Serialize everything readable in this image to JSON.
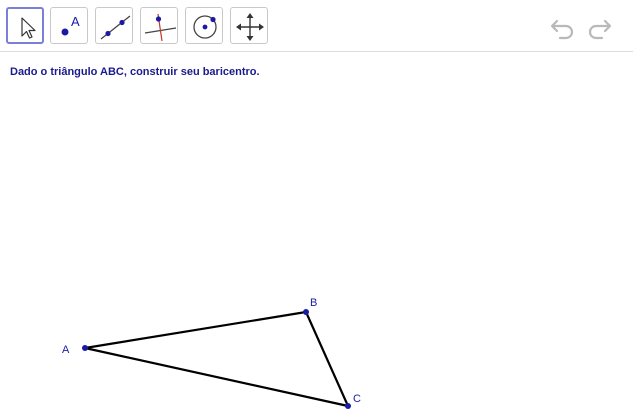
{
  "toolbar": {
    "tools": [
      {
        "id": "move",
        "icon": "arrow-pointer-icon",
        "selected": true
      },
      {
        "id": "point",
        "icon": "point-icon",
        "label": "A"
      },
      {
        "id": "line",
        "icon": "line-through-two-points-icon"
      },
      {
        "id": "perpendicular",
        "icon": "perpendicular-line-icon"
      },
      {
        "id": "circle",
        "icon": "circle-center-point-icon"
      },
      {
        "id": "move-view",
        "icon": "move-graphics-view-icon"
      }
    ],
    "undo_icon": "undo-icon",
    "redo_icon": "redo-icon"
  },
  "task": {
    "text": "Dado o triângulo ABC, construir seu baricentro."
  },
  "construction": {
    "points": [
      {
        "name": "A"
      },
      {
        "name": "B"
      },
      {
        "name": "C"
      }
    ],
    "segments": [
      "AB",
      "BC",
      "CA"
    ],
    "colors": {
      "point": "#1a1aa6",
      "segment": "#000000",
      "perpendicular": "#c0392b"
    }
  }
}
